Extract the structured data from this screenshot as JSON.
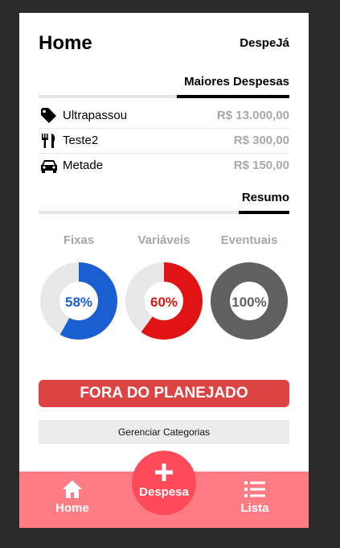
{
  "header": {
    "title": "Home",
    "brand": "DespeJá"
  },
  "top_expenses": {
    "title": "Maiores Despesas",
    "items": [
      {
        "icon": "tag-icon",
        "name": "Ultrapassou",
        "value": "R$ 13.000,00"
      },
      {
        "icon": "cutlery-icon",
        "name": "Teste2",
        "value": "R$ 300,00"
      },
      {
        "icon": "car-icon",
        "name": "Metade",
        "value": "R$ 150,00"
      }
    ]
  },
  "summary": {
    "title": "Resumo",
    "gauges": [
      {
        "label": "Fixas",
        "percent_text": "58%",
        "fraction": 0.58,
        "color": "#1a5fd1"
      },
      {
        "label": "Variáveis",
        "percent_text": "60%",
        "fraction": 0.6,
        "color": "#e01414"
      },
      {
        "label": "Eventuais",
        "percent_text": "100%",
        "fraction": 1.0,
        "color": "#606060"
      }
    ],
    "track_color": "#e8e8e8"
  },
  "status": {
    "label": "FORA DO PLANEJADO",
    "color": "#dc4343"
  },
  "manage_categories": {
    "label": "Gerenciar Categorias"
  },
  "bottom_nav": {
    "color": "#ff7c84",
    "home": {
      "label": "Home",
      "icon": "home-icon"
    },
    "add": {
      "label": "Despesa",
      "icon": "plus-icon",
      "color": "#ff4a5a"
    },
    "list": {
      "label": "Lista",
      "icon": "list-icon"
    }
  }
}
